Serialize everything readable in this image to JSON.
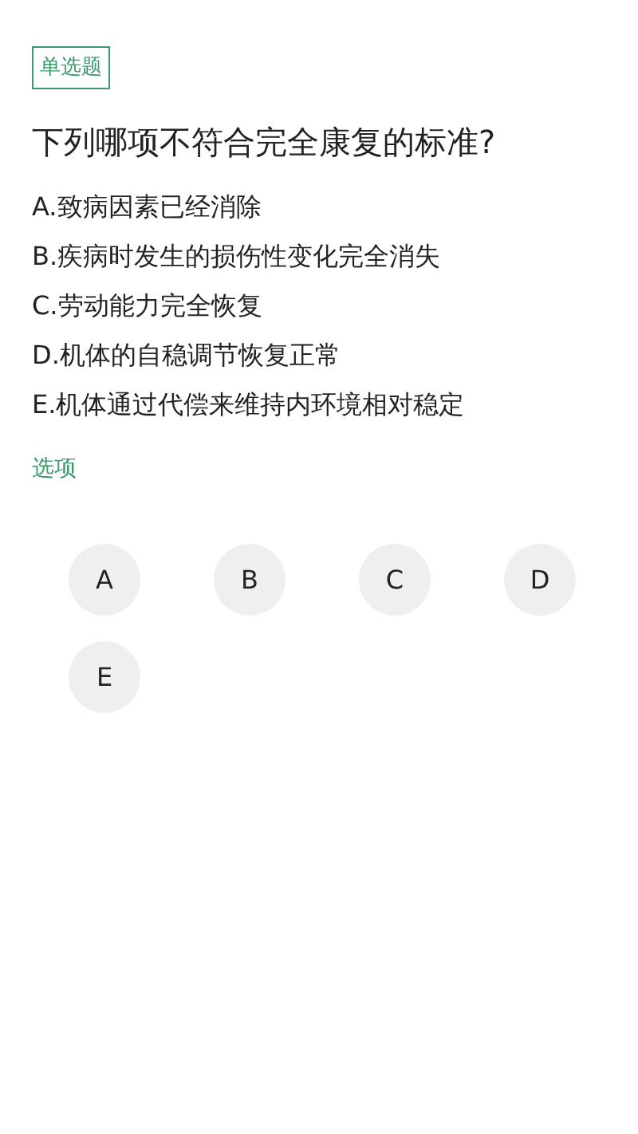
{
  "question_type": "单选题",
  "question": "下列哪项不符合完全康复的标准?",
  "choices": [
    "A.致病因素已经消除",
    "B.疾病时发生的损伤性变化完全消失",
    "C.劳动能力完全恢复",
    "D.机体的自稳调节恢复正常",
    "E.机体通过代偿来维持内环境相对稳定"
  ],
  "options_label": "选项",
  "options": [
    {
      "label": "A",
      "selected": false
    },
    {
      "label": "B",
      "selected": false
    },
    {
      "label": "C",
      "selected": false
    },
    {
      "label": "D",
      "selected": false
    },
    {
      "label": "E",
      "selected": false
    }
  ]
}
